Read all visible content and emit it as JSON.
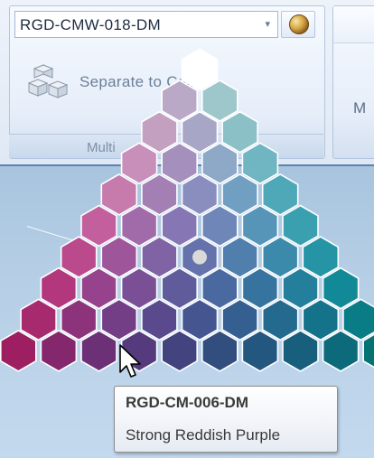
{
  "ribbon": {
    "swatch_combo": {
      "value": "RGD-CMW-018-DM",
      "arrow": "▾"
    },
    "globe_button": {
      "icon": "globe-icon"
    },
    "separate_button": {
      "label": "Separate to Cells",
      "icon": "separate-cells-icon"
    },
    "group_label": "Multi",
    "next_group_label": "M"
  },
  "palette": {
    "name": "triangle-color-picker",
    "rows": [
      [
        "#ffffff"
      ],
      [
        "#b9a8c6",
        "#9ec7cb"
      ],
      [
        "#c3a0c0",
        "#a7a6c6",
        "#8cc0c7"
      ],
      [
        "#c78fb9",
        "#a58fbc",
        "#8ea8c8",
        "#6fb6c2"
      ],
      [
        "#c77aac",
        "#a47fb4",
        "#8a8ebf",
        "#709fc2",
        "#4ea8b8"
      ],
      [
        "#c25f9c",
        "#a16aa8",
        "#8676b3",
        "#6f86b8",
        "#5695b8",
        "#3aa0b0"
      ],
      [
        "#bb4a8c",
        "#9e559a",
        "#8063a4",
        "#6572ab",
        "#507fae",
        "#3c8aab",
        "#2595a5"
      ],
      [
        "#b2377d",
        "#96428c",
        "#7a4f96",
        "#605c9c",
        "#4a69a0",
        "#36749f",
        "#247f9c",
        "#128996"
      ],
      [
        "#a82a6e",
        "#8d337c",
        "#733e86",
        "#5a498d",
        "#45558f",
        "#345f90",
        "#236a8e",
        "#15728b",
        "#0a7c86"
      ],
      [
        "#9d1f62",
        "#85276d",
        "#6c3077",
        "#553a7d",
        "#42437f",
        "#324e7f",
        "#24577f",
        "#175f7d",
        "#0d6a7a",
        "#067373"
      ]
    ],
    "selected_cell": {
      "row": 6,
      "col": 3
    }
  },
  "tooltip": {
    "code": "RGD-CM-006-DM",
    "name": "Strong Reddish Purple"
  }
}
